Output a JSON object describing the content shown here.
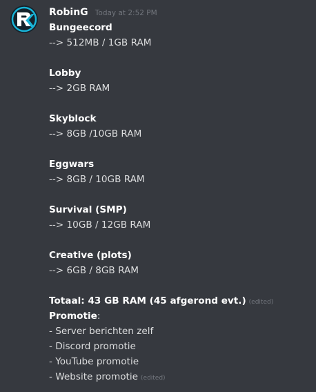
{
  "message": {
    "author": "RobinG",
    "timestamp": "Today at 2:52 PM",
    "edited_label": "(edited)",
    "sections": [
      {
        "title": "Bungeecord",
        "detail": "--> 512MB / 1GB RAM"
      },
      {
        "title": "Lobby",
        "detail": "--> 2GB RAM"
      },
      {
        "title": "Skyblock",
        "detail": "--> 8GB /10GB RAM"
      },
      {
        "title": "Eggwars",
        "detail": "--> 8GB / 10GB RAM"
      },
      {
        "title": "Survival (SMP)",
        "detail": "--> 10GB / 12GB RAM"
      },
      {
        "title": "Creative (plots)",
        "detail": "--> 6GB / 8GB RAM"
      }
    ],
    "total": "Totaal: 43 GB RAM (45 afgerond evt.)",
    "promotie_title": "Promotie",
    "promotie_colon": ":",
    "promotie_items": [
      "- Server berichten zelf",
      "- Discord promotie",
      "- YouTube promotie",
      "- Website promotie"
    ]
  },
  "colors": {
    "background": "#36393f",
    "text": "#dcddde",
    "username": "#ffffff",
    "muted": "#72767d",
    "avatar_accent": "#18b4d8"
  },
  "icons": {
    "avatar": "rk-logo-avatar"
  }
}
